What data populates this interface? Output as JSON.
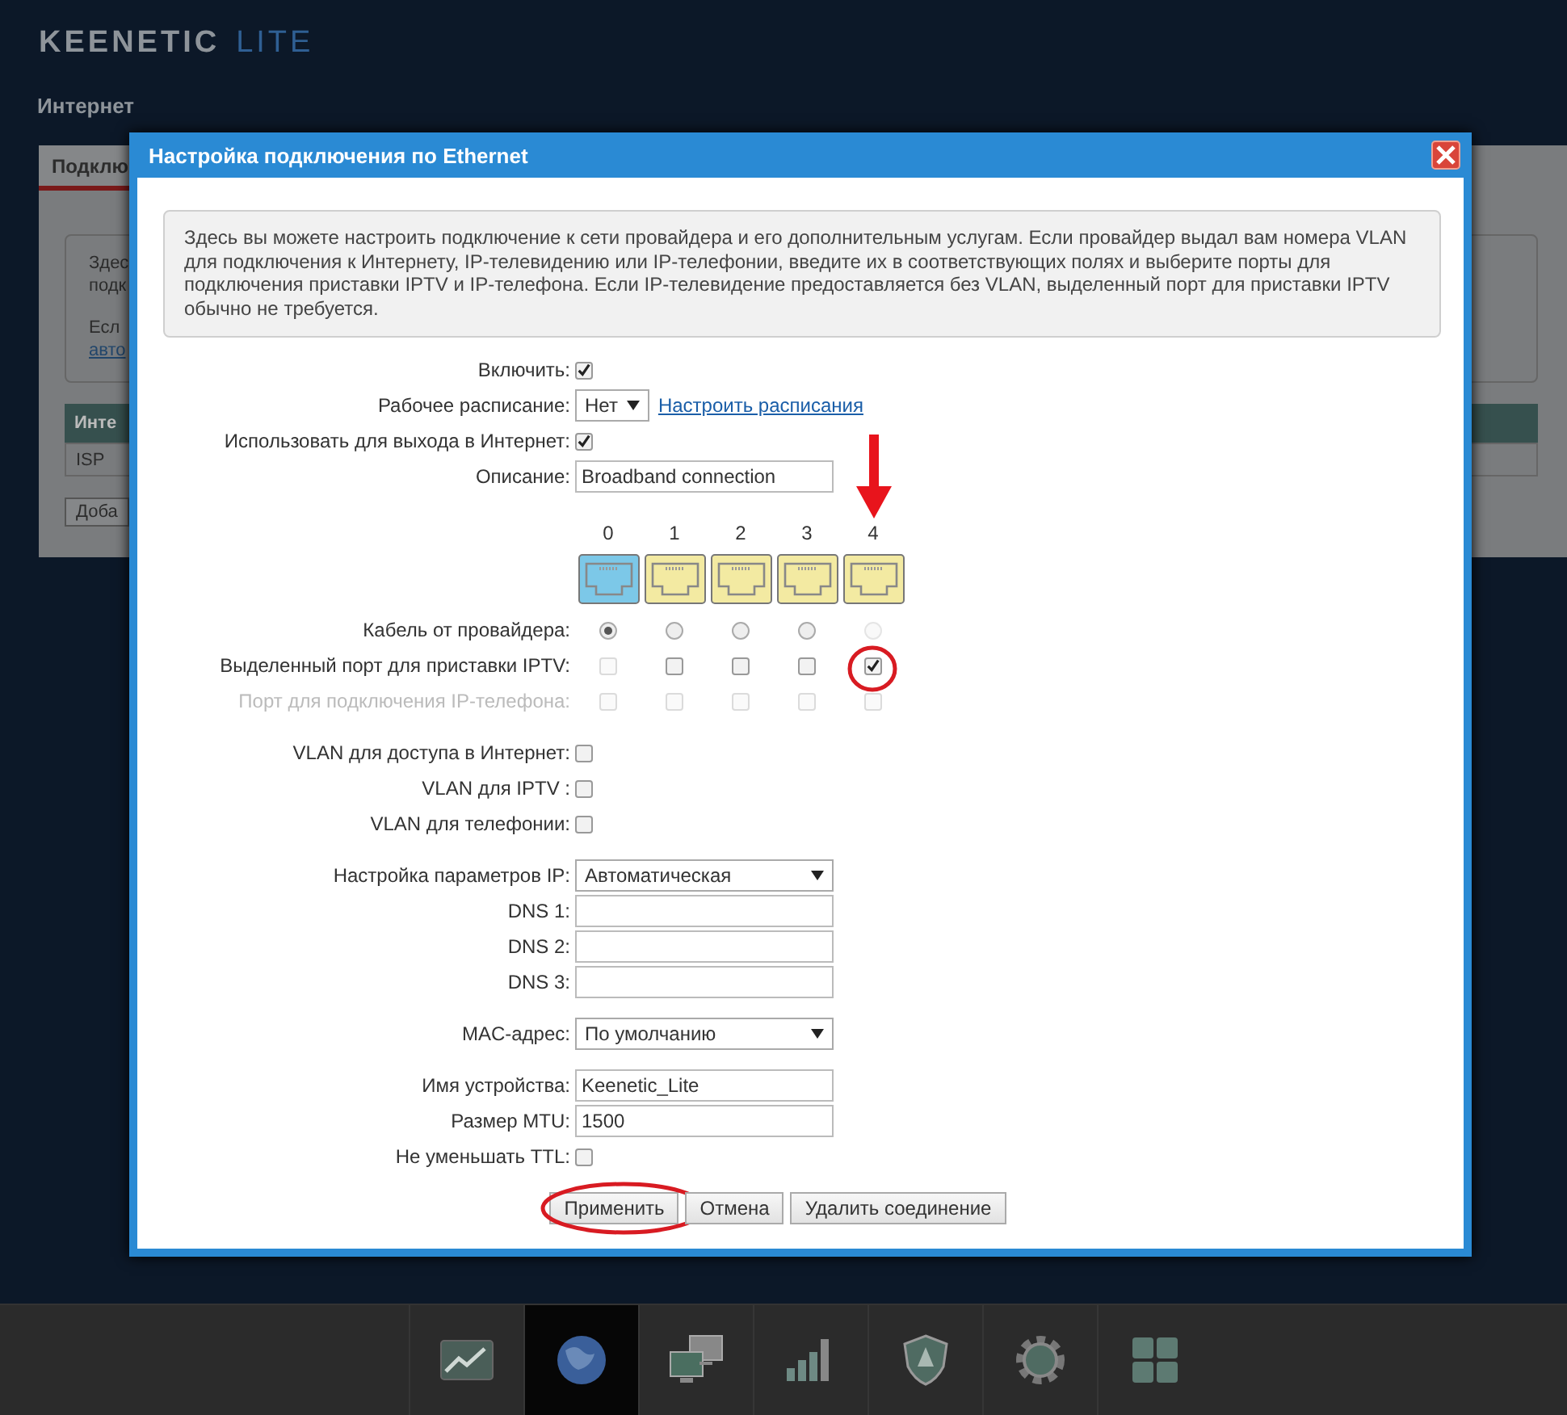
{
  "header": {
    "logo_main": "KEENETIC",
    "logo_sub": "LITE",
    "page_title": "Интернет"
  },
  "background_panel": {
    "tab": "Подклю",
    "info_lines": [
      "Здес",
      "подк"
    ],
    "info_text": "Есл",
    "info_link": "авто",
    "table_header": "Инте",
    "table_row": "ISP",
    "button": "Доба"
  },
  "dialog": {
    "title": "Настройка подключения по Ethernet",
    "description": "Здесь вы можете настроить подключение к сети провайдера и его дополнительным услугам. Если провайдер выдал вам номера VLAN для подключения к Интернету, IP-телевидению или IP-телефонии, введите их в соответствующих полях и выберите порты для подключения приставки IPTV и IP-телефона. Если IP-телевидение предоставляется без VLAN, выделенный порт для приставки IPTV обычно не требуется.",
    "top_fields": [
      {
        "label": "Включить:",
        "kind": "checkbox",
        "checked": true
      },
      {
        "label": "Рабочее расписание:",
        "kind": "select",
        "value": "Нет",
        "link": "Настроить расписания"
      },
      {
        "label": "Использовать для выхода в Интернет:",
        "kind": "checkbox",
        "checked": true
      },
      {
        "label": "Описание:",
        "kind": "text",
        "value": "Broadband connection"
      }
    ],
    "ports": [
      {
        "label": "0",
        "color": "#7cc8e8"
      },
      {
        "label": "1",
        "color": "#f3eaa2"
      },
      {
        "label": "2",
        "color": "#f3eaa2"
      },
      {
        "label": "3",
        "color": "#f3eaa2"
      },
      {
        "label": "4",
        "color": "#f3eaa2"
      }
    ],
    "port_rows": [
      {
        "label": "Кабель от провайдера:",
        "kind": "radio",
        "disabled": false,
        "cells": [
          {
            "selected": true,
            "disabled": false
          },
          {
            "selected": false,
            "disabled": false
          },
          {
            "selected": false,
            "disabled": false
          },
          {
            "selected": false,
            "disabled": false
          },
          {
            "selected": false,
            "disabled": true
          }
        ]
      },
      {
        "label": "Выделенный порт для приставки IPTV:",
        "kind": "checkbox",
        "disabled": false,
        "cells": [
          {
            "checked": false,
            "disabled": true
          },
          {
            "checked": false,
            "disabled": false
          },
          {
            "checked": false,
            "disabled": false
          },
          {
            "checked": false,
            "disabled": false
          },
          {
            "checked": true,
            "disabled": false
          }
        ]
      },
      {
        "label": "Порт для подключения IP-телефона:",
        "kind": "checkbox",
        "disabled": true,
        "cells": [
          {
            "checked": false,
            "disabled": true
          },
          {
            "checked": false,
            "disabled": true
          },
          {
            "checked": false,
            "disabled": true
          },
          {
            "checked": false,
            "disabled": true
          },
          {
            "checked": false,
            "disabled": true
          }
        ]
      }
    ],
    "field_groups": [
      [
        {
          "label": "VLAN для доступа в Интернет:",
          "kind": "checkbox",
          "checked": false
        },
        {
          "label": "VLAN для IPTV :",
          "kind": "checkbox",
          "checked": false
        },
        {
          "label": "VLAN для телефонии:",
          "kind": "checkbox",
          "checked": false
        }
      ],
      [
        {
          "label": "Настройка параметров IP:",
          "kind": "select",
          "value": "Автоматическая"
        },
        {
          "label": "DNS 1:",
          "kind": "text"
        },
        {
          "label": "DNS 2:",
          "kind": "text"
        },
        {
          "label": "DNS 3:",
          "kind": "text"
        }
      ],
      [
        {
          "label": "MAC-адрес:",
          "kind": "select",
          "value": "По умолчанию"
        }
      ],
      [
        {
          "label": "Имя устройства:",
          "kind": "text",
          "value": "Keenetic_Lite"
        },
        {
          "label": "Размер MTU:",
          "kind": "text",
          "value": "1500"
        },
        {
          "label": "Не уменьшать TTL:",
          "kind": "checkbox",
          "checked": false
        }
      ]
    ],
    "buttons": [
      {
        "label": "Применить",
        "kind": "apply"
      },
      {
        "label": "Отмена",
        "kind": "cancel"
      },
      {
        "label": "Удалить соединение",
        "kind": "delete"
      }
    ]
  },
  "taskbar": [
    {
      "kind": "chart",
      "selected": false
    },
    {
      "kind": "globe",
      "selected": true
    },
    {
      "kind": "computers",
      "selected": false
    },
    {
      "kind": "signal",
      "selected": false
    },
    {
      "kind": "shield",
      "selected": false
    },
    {
      "kind": "gear",
      "selected": false
    },
    {
      "kind": "apps",
      "selected": false
    }
  ]
}
